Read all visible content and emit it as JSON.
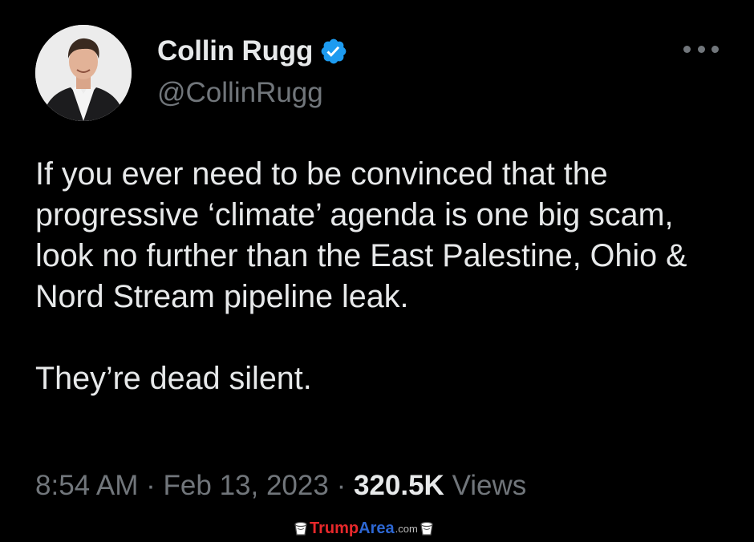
{
  "author": {
    "display_name": "Collin Rugg",
    "handle": "@CollinRugg",
    "verified": true,
    "avatar": "profile-photo"
  },
  "menu": {
    "icon": "more-horizontal-icon"
  },
  "tweet": {
    "paragraphs": [
      "If you ever need to be convinced that the progressive ‘climate’ agenda is one big scam, look no further than the East Palestine, Ohio & Nord Stream pipeline leak.",
      "They’re dead silent."
    ],
    "time": "8:54 AM",
    "separator": "·",
    "date": "Feb 13, 2023",
    "views_count": "320.5K",
    "views_label": "Views"
  },
  "watermark": {
    "part1": "Trump",
    "part2": "Area",
    "part3": ".com"
  },
  "colors": {
    "background": "#000000",
    "text_primary": "#e7e9ea",
    "text_secondary": "#71767b",
    "verified_blue": "#1d9bf0",
    "watermark_red": "#e8282b",
    "watermark_blue": "#2d67d3"
  }
}
